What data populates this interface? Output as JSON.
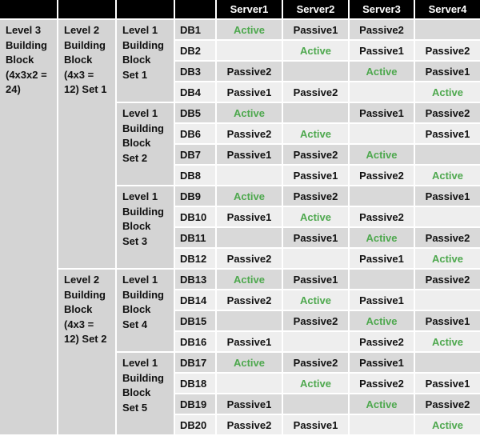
{
  "header": [
    "",
    "",
    "",
    "",
    "Server1",
    "Server2",
    "Server3",
    "Server4"
  ],
  "colors": {
    "active": "#4ea84e",
    "header_bg": "#000000",
    "row_dark": "#d9d9d9",
    "row_light": "#eeeeee"
  },
  "level3": {
    "label": "Level 3 Building Block (4x3x2 = 24)"
  },
  "level2": [
    {
      "label": "Level 2 Building Block (4x3 = 12) Set 1"
    },
    {
      "label": "Level 2 Building Block (4x3 = 12) Set 2"
    }
  ],
  "level1": [
    {
      "label": "Level 1 Building Block Set 1"
    },
    {
      "label": "Level 1 Building Block Set 2"
    },
    {
      "label": "Level 1 Building Block Set 3"
    },
    {
      "label": "Level 1 Building Block Set 4"
    },
    {
      "label": "Level 1 Building Block Set 5"
    }
  ],
  "rows": [
    {
      "db": "DB1",
      "servers": [
        "Active",
        "Passive1",
        "Passive2",
        ""
      ]
    },
    {
      "db": "DB2",
      "servers": [
        "",
        "Active",
        "Passive1",
        "Passive2"
      ]
    },
    {
      "db": "DB3",
      "servers": [
        "Passive2",
        "",
        "Active",
        "Passive1"
      ]
    },
    {
      "db": "DB4",
      "servers": [
        "Passive1",
        "Passive2",
        "",
        "Active"
      ]
    },
    {
      "db": "DB5",
      "servers": [
        "Active",
        "",
        "Passive1",
        "Passive2"
      ]
    },
    {
      "db": "DB6",
      "servers": [
        "Passive2",
        "Active",
        "",
        "Passive1"
      ]
    },
    {
      "db": "DB7",
      "servers": [
        "Passive1",
        "Passive2",
        "Active",
        ""
      ]
    },
    {
      "db": "DB8",
      "servers": [
        "",
        "Passive1",
        "Passive2",
        "Active"
      ]
    },
    {
      "db": "DB9",
      "servers": [
        "Active",
        "Passive2",
        "",
        "Passive1"
      ]
    },
    {
      "db": "DB10",
      "servers": [
        "Passive1",
        "Active",
        "Passive2",
        ""
      ]
    },
    {
      "db": "DB11",
      "servers": [
        "",
        "Passive1",
        "Active",
        "Passive2"
      ]
    },
    {
      "db": "DB12",
      "servers": [
        "Passive2",
        "",
        "Passive1",
        "Active"
      ]
    },
    {
      "db": "DB13",
      "servers": [
        "Active",
        "Passive1",
        "",
        "Passive2"
      ]
    },
    {
      "db": "DB14",
      "servers": [
        "Passive2",
        "Active",
        "Passive1",
        ""
      ]
    },
    {
      "db": "DB15",
      "servers": [
        "",
        "Passive2",
        "Active",
        "Passive1"
      ]
    },
    {
      "db": "DB16",
      "servers": [
        "Passive1",
        "",
        "Passive2",
        "Active"
      ]
    },
    {
      "db": "DB17",
      "servers": [
        "Active",
        "Passive2",
        "Passive1",
        ""
      ]
    },
    {
      "db": "DB18",
      "servers": [
        "",
        "Active",
        "Passive2",
        "Passive1"
      ]
    },
    {
      "db": "DB19",
      "servers": [
        "Passive1",
        "",
        "Active",
        "Passive2"
      ]
    },
    {
      "db": "DB20",
      "servers": [
        "Passive2",
        "Passive1",
        "",
        "Active"
      ]
    }
  ]
}
